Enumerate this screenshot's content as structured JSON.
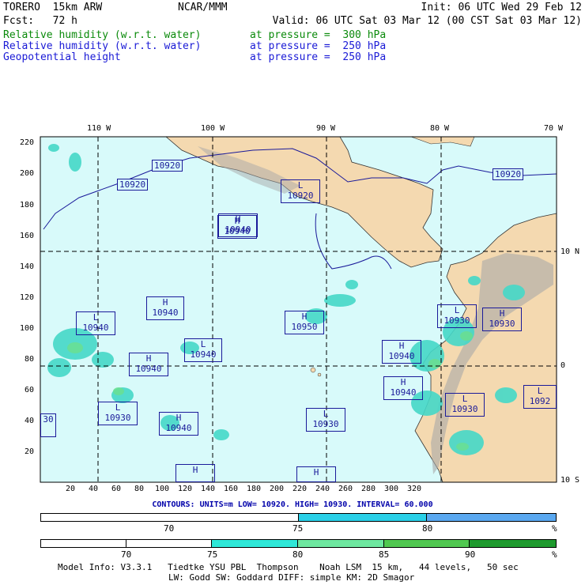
{
  "header": {
    "model": "TORERO  15km ARW",
    "center": "NCAR/MMM",
    "init": "Init: 06 UTC Wed 29 Feb 12",
    "fcst": "Fcst:   72 h",
    "valid": "Valid: 06 UTC Sat 03 Mar 12 (00 CST Sat 03 Mar 12)",
    "fields": [
      {
        "name": "Relative humidity (w.r.t. water)",
        "level": "at pressure =  300 hPa",
        "color": "#0a8a0a"
      },
      {
        "name": "Relative humidity (w.r.t. water)",
        "level": "at pressure =  250 hPa",
        "color": "#1a1ad6"
      },
      {
        "name": "Geopotential height",
        "level": "at pressure =  250 hPa",
        "color": "#1a1ad6"
      }
    ]
  },
  "map": {
    "top_lon_labels": [
      "110 W",
      "100 W",
      "90 W",
      "80 W",
      "70 W"
    ],
    "right_lat_labels": [
      "10 N",
      "0",
      "10 S"
    ],
    "x_ticks": [
      "20",
      "40",
      "60",
      "80",
      "100",
      "120",
      "140",
      "160",
      "180",
      "200",
      "220",
      "240",
      "260",
      "280",
      "300",
      "320"
    ],
    "y_ticks": [
      "220",
      "200",
      "180",
      "160",
      "140",
      "120",
      "100",
      "80",
      "60",
      "40",
      "20"
    ],
    "colors": {
      "ocean": "#d8fafa",
      "land": "#f4d9b0",
      "terrain": "#9a9a9a",
      "contour": "#1a1a9a",
      "rh_cyan": "#45d8c8",
      "rh_green": "#6adf90"
    },
    "centers": [
      {
        "type": "H",
        "value": "10940"
      },
      {
        "type": "H",
        "value": "10940"
      },
      {
        "type": "L",
        "value": "10940"
      },
      {
        "type": "H",
        "value": "10940"
      },
      {
        "type": "L",
        "value": "10940"
      },
      {
        "type": "H",
        "value": "10950"
      },
      {
        "type": "L",
        "value": "10930"
      },
      {
        "type": "H",
        "value": "10940"
      },
      {
        "type": "L",
        "value": "10920"
      },
      {
        "type": "H",
        "value": "10930"
      },
      {
        "type": "H",
        "value": "10940"
      },
      {
        "type": "H",
        "value": "10940"
      },
      {
        "type": "L",
        "value": "10930"
      },
      {
        "type": "L",
        "value": "10930"
      },
      {
        "type": "L",
        "value": "10930"
      },
      {
        "type": "H",
        "value": "10940"
      },
      {
        "type": "L",
        "value": "1092"
      },
      {
        "type": "H",
        "value": ""
      },
      {
        "type": "H",
        "value": ""
      },
      {
        "type": "",
        "value": "30"
      }
    ],
    "contour_labels": [
      "10920",
      "10920",
      "10920"
    ]
  },
  "contours_line": "CONTOURS:  UNITS=m  LOW=  10920.     HIGH=  10930.     INTERVAL=   60.000",
  "legend1": {
    "ticks": [
      "70",
      "75",
      "80"
    ],
    "unit": "%",
    "colors": [
      "#ffffff",
      "#2ad0e8",
      "#5aa8f0"
    ]
  },
  "legend2": {
    "ticks": [
      "70",
      "75",
      "80",
      "85",
      "90"
    ],
    "unit": "%",
    "colors": [
      "#ffffff",
      "#ffffff",
      "#2ee8d8",
      "#6ee8a0",
      "#50c850",
      "#1e9a2e"
    ]
  },
  "footer": {
    "line1": "Model Info: V3.3.1   Tiedtke YSU PBL  Thompson    Noah LSM  15 km,   44 levels,   50 sec",
    "line2": "LW: Godd SW: Goddard DIFF: simple KM: 2D Smagor"
  }
}
